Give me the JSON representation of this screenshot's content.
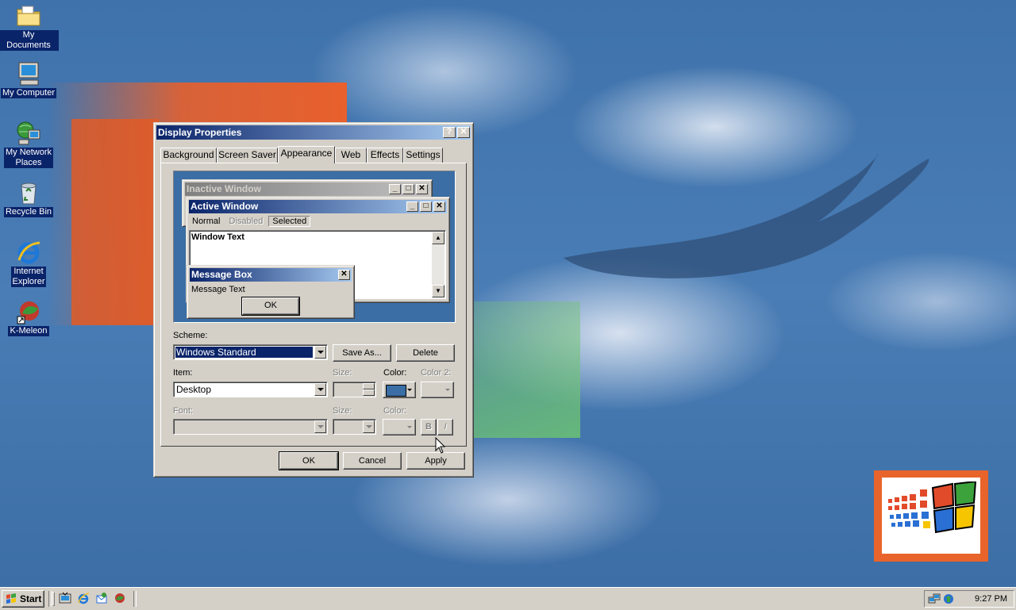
{
  "desktop": {
    "icons": [
      {
        "label": "My Documents"
      },
      {
        "label": "My Computer"
      },
      {
        "label_line1": "My Network",
        "label_line2": "Places"
      },
      {
        "label": "Recycle Bin"
      },
      {
        "label_line1": "Internet",
        "label_line2": "Explorer"
      },
      {
        "label": "K-Meleon"
      }
    ]
  },
  "dialog": {
    "title": "Display Properties",
    "help_glyph": "?",
    "close_glyph": "✕",
    "tabs": [
      "Background",
      "Screen Saver",
      "Appearance",
      "Web",
      "Effects",
      "Settings"
    ],
    "active_tab": "Appearance",
    "preview": {
      "inactive_title": "Inactive Window",
      "active_title": "Active Window",
      "menu_normal": "Normal",
      "menu_disabled": "Disabled",
      "menu_selected": "Selected",
      "window_text": "Window Text",
      "msgbox_title": "Message Box",
      "msgbox_text": "Message Text",
      "msgbox_ok": "OK"
    },
    "scheme": {
      "label": "Scheme:",
      "value": "Windows Standard",
      "save_as": "Save As...",
      "delete": "Delete"
    },
    "item": {
      "label": "Item:",
      "value": "Desktop",
      "size_label": "Size:",
      "color_label": "Color:",
      "color2_label": "Color 2:",
      "color_value": "#3a6ea5"
    },
    "font": {
      "label": "Font:",
      "size_label": "Size:",
      "color_label": "Color:",
      "bold": "B",
      "italic": "I"
    },
    "buttons": {
      "ok": "OK",
      "cancel": "Cancel",
      "apply": "Apply"
    }
  },
  "taskbar": {
    "start_label": "Start",
    "clock": "9:27 PM"
  },
  "colors": {
    "titlebar": "#0a246a",
    "desktop": "#3a6ea5",
    "face": "#d4d0c8"
  }
}
